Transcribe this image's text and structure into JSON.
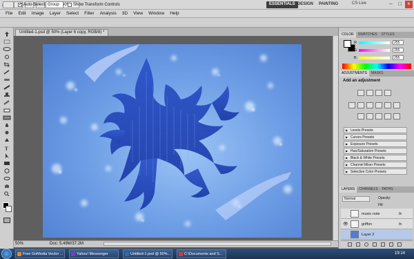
{
  "app": {
    "logo": "Ps",
    "zoom": "50%",
    "workspaces": {
      "essentials": "ESSENTIALS",
      "design": "DESIGN",
      "painting": "PAINTING"
    },
    "cs_live": "CS Live"
  },
  "menu": [
    "File",
    "Edit",
    "Image",
    "Layer",
    "Select",
    "Filter",
    "Analysis",
    "3D",
    "View",
    "Window",
    "Help"
  ],
  "options_bar": {
    "auto_select_label": "Auto-Select:",
    "auto_select_value": "Group",
    "show_transform_label": "Show Transform Controls"
  },
  "document": {
    "tab_title": "Untitled-1.psd @ 50% (Layer 6 copy, RGB/8) *",
    "zoom": "50%",
    "doc_size": "Doc: 5.49M/37.2M"
  },
  "panels": {
    "color_tabs": [
      "COLOR",
      "SWATCHES",
      "STYLES"
    ],
    "color": {
      "r_label": "R",
      "g_label": "G",
      "b_label": "B",
      "r": "255",
      "g": "255",
      "b": "255"
    },
    "adjust_tabs": [
      "ADJUSTMENTS",
      "MASKS"
    ],
    "adjust_title": "Add an adjustment",
    "presets": [
      "Levels Presets",
      "Curves Presets",
      "Exposure Presets",
      "Hue/Saturation Presets",
      "Black & White Presets",
      "Channel Mixer Presets",
      "Selective Color Presets"
    ],
    "layers_tabs": [
      "LAYERS",
      "CHANNELS",
      "PATHS"
    ],
    "blend_mode": "Normal",
    "opacity_label": "Opacity:",
    "fill_label": "Fill:",
    "layers": [
      {
        "name": "music note",
        "fx": "fx",
        "selected": false
      },
      {
        "name": "griffon",
        "fx": "fx",
        "selected": false
      },
      {
        "name": "Layer 2",
        "fx": "",
        "selected": true
      }
    ]
  },
  "taskbar": {
    "items": [
      {
        "label": "Free GoMedia Vector ...",
        "color": "#e8862c"
      },
      {
        "label": "Yahoo! Messenger",
        "color": "#7b3fb2"
      },
      {
        "label": "Untitled-1.psd @ 50%...",
        "color": "#2b6db3"
      },
      {
        "label": "C:\\Documents and S...",
        "color": "#d83a2a"
      }
    ],
    "clock": "19:14"
  },
  "colors": {
    "accent": "#3d6fb4",
    "canvas_bg": "#5f8fd9",
    "dragon": "#1f43b8"
  }
}
